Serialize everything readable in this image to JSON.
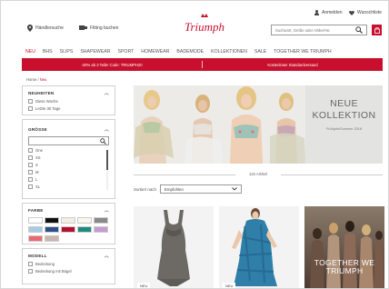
{
  "header": {
    "store_label": "Händlersuche",
    "fitting_label": "Fitting buchen",
    "brand": "Triumph",
    "login_label": "Anmelden",
    "wishlist_label": "Wunschliste",
    "search_placeholder": "Suchwort, Größe oder Artikel-Nr."
  },
  "nav": {
    "items": [
      "NEU",
      "BHS",
      "SLIPS",
      "SHAPEWEAR",
      "SPORT",
      "HOMEWEAR",
      "BADEMODE",
      "KOLLEKTIONEN",
      "SALE",
      "TOGETHER WE TRIUMPH"
    ],
    "active_index": 0
  },
  "promo": {
    "left": "-20% ab 3 Teile! Code: TRIUMPH20",
    "right": "Kostenloser Standardversand"
  },
  "breadcrumb": {
    "home": "Home",
    "sep": "/",
    "current": "Neu"
  },
  "filters": {
    "neuheiten": {
      "title": "NEUHEITEN",
      "options": [
        "Diese Woche",
        "Letzte 30 Tage"
      ]
    },
    "groesse": {
      "title": "GRÖSSE",
      "options": [
        "One",
        "XS",
        "S",
        "M",
        "L",
        "XL"
      ]
    },
    "farbe": {
      "title": "FARBE",
      "colors": [
        "#ffffff",
        "#111111",
        "#f4eee3",
        "#fbf7ee",
        "#8a8a8a",
        "#a9c9e6",
        "#2f4f88",
        "#b40f2f",
        "#1f8a7e",
        "#c79ad2",
        "#ea6a72",
        "#c9b6ae"
      ]
    },
    "modell": {
      "title": "MODELL",
      "options": [
        "Bedeckung",
        "Bedeckung mit Bügel"
      ]
    }
  },
  "hero": {
    "title_line1": "NEUE",
    "title_line2": "KOLLEKTION",
    "subtitle": "Frühjahr/Sommer 2018"
  },
  "listing": {
    "count_label": "115 Artikel",
    "sort_label": "Sortiert nach",
    "sort_value": "Empfohlen"
  },
  "products": [
    {
      "badge": "NEU"
    },
    {
      "badge": "NEU"
    },
    {
      "overlay_line1": "TOGETHER WE",
      "overlay_line2": "TRIUMPH"
    }
  ],
  "colors": {
    "accent": "#c8102e"
  }
}
